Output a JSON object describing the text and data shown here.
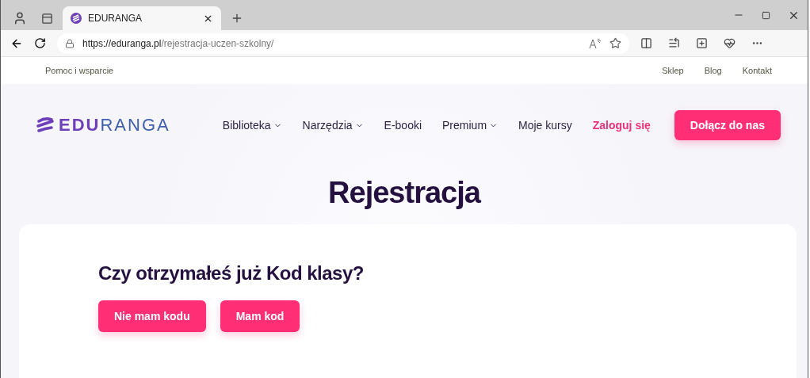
{
  "browser": {
    "tab_title": "EDURANGA",
    "url_host": "https://eduranga.pl",
    "url_path": "/rejestracja-uczen-szkolny/"
  },
  "top_bar": {
    "left_link": "Pomoc i wsparcie",
    "right_links": [
      "Sklep",
      "Blog",
      "Kontakt"
    ]
  },
  "logo": {
    "strong": "EDU",
    "light": "RANGA"
  },
  "nav": [
    {
      "label": "Biblioteka",
      "dropdown": true
    },
    {
      "label": "Narzędzia",
      "dropdown": true
    },
    {
      "label": "E-booki",
      "dropdown": false
    },
    {
      "label": "Premium",
      "dropdown": true
    },
    {
      "label": "Moje kursy",
      "dropdown": false
    }
  ],
  "login_link": "Zaloguj się",
  "join_button": "Dołącz do nas",
  "page_title": "Rejestracja",
  "card": {
    "question": "Czy otrzymałeś już Kod klasy?",
    "buttons": [
      "Nie mam kodu",
      "Mam kod"
    ]
  }
}
